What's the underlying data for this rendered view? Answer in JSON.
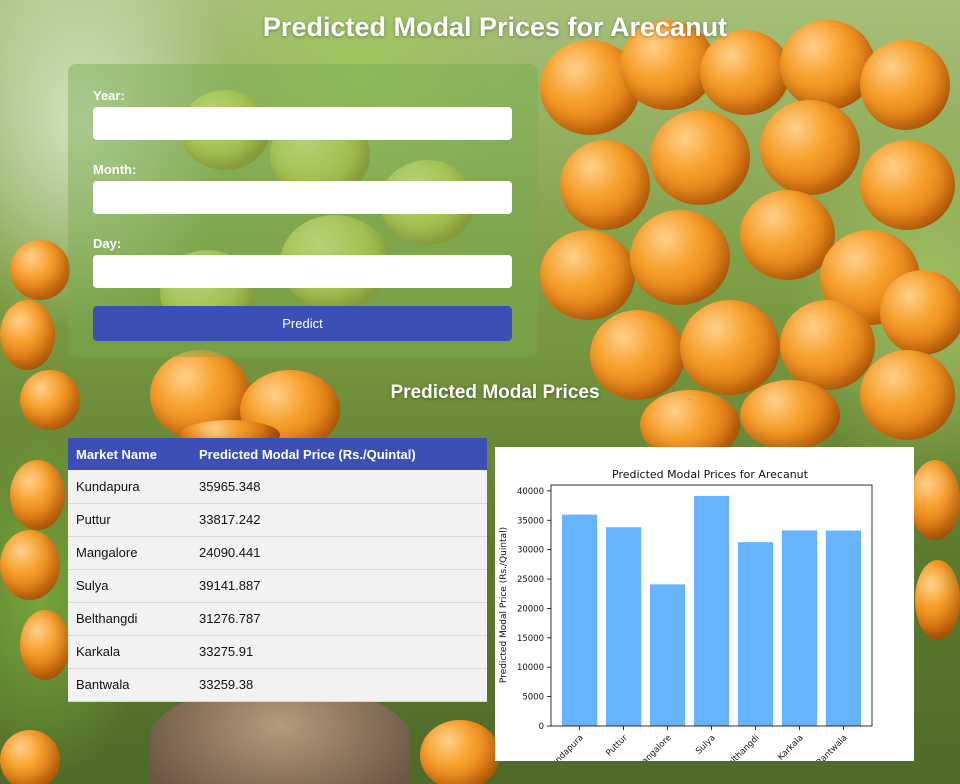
{
  "page": {
    "title": "Predicted Modal Prices for Arecanut",
    "results_heading": "Predicted Modal Prices"
  },
  "form": {
    "year_label": "Year:",
    "year_value": "",
    "month_label": "Month:",
    "month_value": "",
    "day_label": "Day:",
    "day_value": "",
    "predict_label": "Predict"
  },
  "table": {
    "headers": [
      "Market Name",
      "Predicted Modal Price (Rs./Quintal)"
    ],
    "rows": [
      [
        "Kundapura",
        "35965.348"
      ],
      [
        "Puttur",
        "33817.242"
      ],
      [
        "Mangalore",
        "24090.441"
      ],
      [
        "Sulya",
        "39141.887"
      ],
      [
        "Belthangdi",
        "31276.787"
      ],
      [
        "Karkala",
        "33275.91"
      ],
      [
        "Bantwala",
        "33259.38"
      ]
    ]
  },
  "colors": {
    "accent": "#3c4fb7",
    "bar": "#66b3ff"
  },
  "chart_data": {
    "type": "bar",
    "title": "Predicted Modal Prices for Arecanut",
    "xlabel": "",
    "ylabel": "Predicted Modal Price (Rs./Quintal)",
    "categories": [
      "Kundapura",
      "Puttur",
      "Mangalore",
      "Sulya",
      "Belthangdi",
      "Karkala",
      "Bantwala"
    ],
    "values": [
      35965.348,
      33817.242,
      24090.441,
      39141.887,
      31276.787,
      33275.91,
      33259.38
    ],
    "yticks": [
      0,
      5000,
      10000,
      15000,
      20000,
      25000,
      30000,
      35000,
      40000
    ],
    "ylim": [
      0,
      41000
    ],
    "grid": false,
    "legend": "none"
  }
}
